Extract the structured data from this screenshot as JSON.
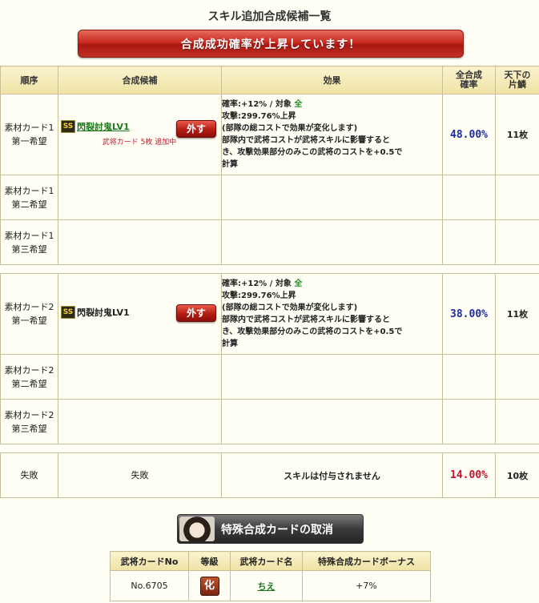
{
  "page_title": "スキル追加合成候補一覧",
  "banner": "合成成功確率が上昇しています！",
  "headers": {
    "order": "順序",
    "candidate": "合成候補",
    "effect": "効果",
    "rate": "全合成確率",
    "count": "天下の片鱗"
  },
  "group1": {
    "row1": {
      "order_a": "素材カード1",
      "order_b": "第一希望",
      "badge": "SS",
      "skill": "閃裂討鬼LV1",
      "remove": "外す",
      "added": "武将カード 5枚 追加中",
      "effect_l1a": "確率:+12% / 対象 ",
      "effect_l1b": "全",
      "effect_l2": "攻撃:299.76%上昇",
      "effect_l3": "(部隊の総コストで効果が変化します)",
      "effect_l4": "部隊内で武将コストが武将スキルに影響すると",
      "effect_l5": "き、攻撃効果部分のみこの武将のコストを+0.5で",
      "effect_l6": "計算",
      "rate": "48.00%",
      "count": "11枚"
    },
    "row2": {
      "order_a": "素材カード1",
      "order_b": "第二希望"
    },
    "row3": {
      "order_a": "素材カード1",
      "order_b": "第三希望"
    }
  },
  "group2": {
    "row1": {
      "order_a": "素材カード2",
      "order_b": "第一希望",
      "badge": "SS",
      "skill": "閃裂討鬼LV1",
      "remove": "外す",
      "effect_l1a": "確率:+12% / 対象 ",
      "effect_l1b": "全",
      "effect_l2": "攻撃:299.76%上昇",
      "effect_l3": "(部隊の総コストで効果が変化します)",
      "effect_l4": "部隊内で武将コストが武将スキルに影響すると",
      "effect_l5": "き、攻撃効果部分のみこの武将のコストを+0.5で",
      "effect_l6": "計算",
      "rate": "38.00%",
      "count": "11枚"
    },
    "row2": {
      "order_a": "素材カード2",
      "order_b": "第二希望"
    },
    "row3": {
      "order_a": "素材カード2",
      "order_b": "第三希望"
    }
  },
  "failure": {
    "order": "失敗",
    "candidate": "失敗",
    "effect": "スキルは付与されません",
    "rate": "14.00%",
    "count": "10枚"
  },
  "special_button": "特殊合成カードの取消",
  "sub_table": {
    "headers": {
      "no": "武将カードNo",
      "grade": "等級",
      "name": "武将カード名",
      "bonus": "特殊合成カードボーナス"
    },
    "row": {
      "no": "No.6705",
      "grade": "化",
      "name": "ちえ",
      "bonus": "+7%"
    }
  },
  "colors": {
    "rate_blue": "#1a2ba8",
    "rate_red": "#c8102e",
    "banner_red": "#c92a20",
    "link_green": "#1e7a1e"
  }
}
